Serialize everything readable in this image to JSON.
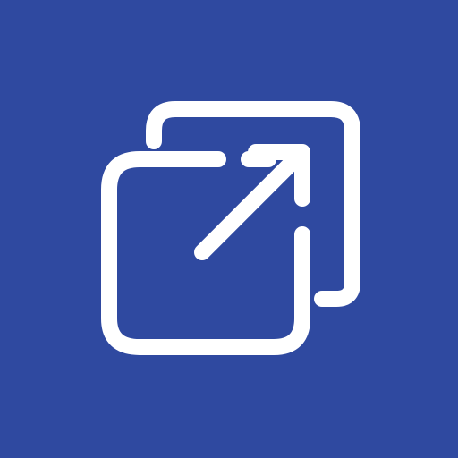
{
  "icon": {
    "name": "open-in-new-window-icon",
    "background_color": "#2f49a0",
    "stroke_color": "#ffffff"
  }
}
